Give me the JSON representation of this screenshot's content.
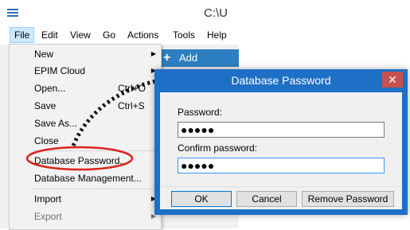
{
  "app": {
    "title": "C:\\U",
    "menu": [
      "File",
      "Edit",
      "View",
      "Go",
      "Actions",
      "Tools",
      "Help"
    ],
    "add_contact_label": "Add Contact"
  },
  "file_menu": {
    "items": [
      {
        "label": "New",
        "shortcut": "",
        "submenu": true
      },
      {
        "label": "EPIM Cloud",
        "shortcut": "",
        "submenu": true
      },
      {
        "label": "Open...",
        "shortcut": "Ctrl+O",
        "submenu": false
      },
      {
        "label": "Save",
        "shortcut": "Ctrl+S",
        "submenu": false
      },
      {
        "label": "Save As...",
        "shortcut": "",
        "submenu": false
      },
      {
        "label": "Close",
        "shortcut": "",
        "submenu": false
      },
      {
        "label": "Database Password...",
        "shortcut": "",
        "submenu": false
      },
      {
        "label": "Database Management...",
        "shortcut": "",
        "submenu": false
      },
      {
        "label": "Import",
        "shortcut": "",
        "submenu": true
      },
      {
        "label": "Export",
        "shortcut": "",
        "submenu": true
      }
    ]
  },
  "dialog": {
    "title": "Database Password",
    "close_glyph": "✕",
    "password_label": "Password:",
    "password_value": "●●●●●",
    "confirm_label": "Confirm password:",
    "confirm_value": "●●●●●",
    "ok_label": "OK",
    "cancel_label": "Cancel",
    "remove_label": "Remove Password"
  },
  "colors": {
    "dialog_frame": "#1e6fc6",
    "highlight_ellipse": "#d9241c",
    "add_contact": "#2d7fc1",
    "menu_active": "#cde8ff"
  }
}
